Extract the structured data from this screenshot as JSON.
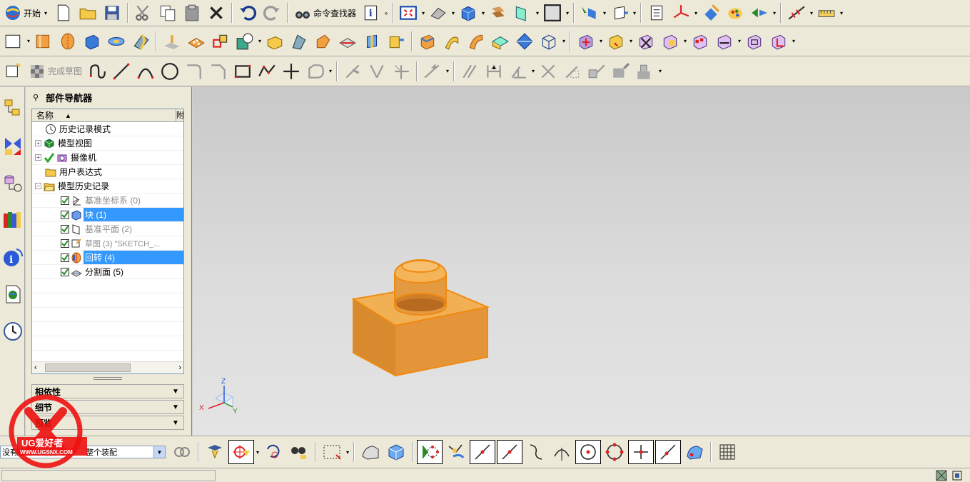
{
  "toolbar1": {
    "start_label": "开始",
    "command_finder_label": "命令查找器"
  },
  "toolbar3": {
    "finish_sketch_label": "完成草图"
  },
  "navigator": {
    "title": "部件导航器",
    "column_name": "名称",
    "column_extra": "附",
    "items": [
      {
        "label": "历史记录模式"
      },
      {
        "label": "模型视图"
      },
      {
        "label": "摄像机"
      },
      {
        "label": "用户表达式"
      },
      {
        "label": "模型历史记录"
      },
      {
        "label": "基准坐标系 (0)"
      },
      {
        "label": "块 (1)"
      },
      {
        "label": "基准平面 (2)"
      },
      {
        "label": "草图 (3) \"SKETCH_..."
      },
      {
        "label": "回转 (4)"
      },
      {
        "label": "分割面 (5)"
      }
    ],
    "panels": {
      "dependencies": "相依性",
      "details": "细节",
      "preview": "预览"
    }
  },
  "viewport": {
    "triad_x": "X",
    "triad_y": "Y",
    "triad_z": "Z"
  },
  "selection_bar": {
    "filter_value": "没有选择过滤器",
    "scope_value": "整个装配"
  },
  "watermark": {
    "brand": "UG爱好者",
    "url": "WWW.UGSNX.COM"
  },
  "colors": {
    "selection_blue": "#3399ff",
    "part_orange": "#f0a040",
    "toolbar_bg": "#ece9d8",
    "viewport_bg": "#d8d8d8"
  }
}
